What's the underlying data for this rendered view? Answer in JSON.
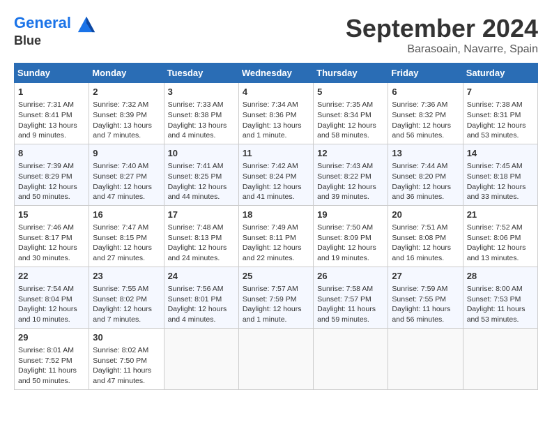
{
  "header": {
    "logo_line1": "General",
    "logo_line2": "Blue",
    "month": "September 2024",
    "location": "Barasoain, Navarre, Spain"
  },
  "weekdays": [
    "Sunday",
    "Monday",
    "Tuesday",
    "Wednesday",
    "Thursday",
    "Friday",
    "Saturday"
  ],
  "weeks": [
    [
      {
        "day": "1",
        "info": "Sunrise: 7:31 AM\nSunset: 8:41 PM\nDaylight: 13 hours\nand 9 minutes."
      },
      {
        "day": "2",
        "info": "Sunrise: 7:32 AM\nSunset: 8:39 PM\nDaylight: 13 hours\nand 7 minutes."
      },
      {
        "day": "3",
        "info": "Sunrise: 7:33 AM\nSunset: 8:38 PM\nDaylight: 13 hours\nand 4 minutes."
      },
      {
        "day": "4",
        "info": "Sunrise: 7:34 AM\nSunset: 8:36 PM\nDaylight: 13 hours\nand 1 minute."
      },
      {
        "day": "5",
        "info": "Sunrise: 7:35 AM\nSunset: 8:34 PM\nDaylight: 12 hours\nand 58 minutes."
      },
      {
        "day": "6",
        "info": "Sunrise: 7:36 AM\nSunset: 8:32 PM\nDaylight: 12 hours\nand 56 minutes."
      },
      {
        "day": "7",
        "info": "Sunrise: 7:38 AM\nSunset: 8:31 PM\nDaylight: 12 hours\nand 53 minutes."
      }
    ],
    [
      {
        "day": "8",
        "info": "Sunrise: 7:39 AM\nSunset: 8:29 PM\nDaylight: 12 hours\nand 50 minutes."
      },
      {
        "day": "9",
        "info": "Sunrise: 7:40 AM\nSunset: 8:27 PM\nDaylight: 12 hours\nand 47 minutes."
      },
      {
        "day": "10",
        "info": "Sunrise: 7:41 AM\nSunset: 8:25 PM\nDaylight: 12 hours\nand 44 minutes."
      },
      {
        "day": "11",
        "info": "Sunrise: 7:42 AM\nSunset: 8:24 PM\nDaylight: 12 hours\nand 41 minutes."
      },
      {
        "day": "12",
        "info": "Sunrise: 7:43 AM\nSunset: 8:22 PM\nDaylight: 12 hours\nand 39 minutes."
      },
      {
        "day": "13",
        "info": "Sunrise: 7:44 AM\nSunset: 8:20 PM\nDaylight: 12 hours\nand 36 minutes."
      },
      {
        "day": "14",
        "info": "Sunrise: 7:45 AM\nSunset: 8:18 PM\nDaylight: 12 hours\nand 33 minutes."
      }
    ],
    [
      {
        "day": "15",
        "info": "Sunrise: 7:46 AM\nSunset: 8:17 PM\nDaylight: 12 hours\nand 30 minutes."
      },
      {
        "day": "16",
        "info": "Sunrise: 7:47 AM\nSunset: 8:15 PM\nDaylight: 12 hours\nand 27 minutes."
      },
      {
        "day": "17",
        "info": "Sunrise: 7:48 AM\nSunset: 8:13 PM\nDaylight: 12 hours\nand 24 minutes."
      },
      {
        "day": "18",
        "info": "Sunrise: 7:49 AM\nSunset: 8:11 PM\nDaylight: 12 hours\nand 22 minutes."
      },
      {
        "day": "19",
        "info": "Sunrise: 7:50 AM\nSunset: 8:09 PM\nDaylight: 12 hours\nand 19 minutes."
      },
      {
        "day": "20",
        "info": "Sunrise: 7:51 AM\nSunset: 8:08 PM\nDaylight: 12 hours\nand 16 minutes."
      },
      {
        "day": "21",
        "info": "Sunrise: 7:52 AM\nSunset: 8:06 PM\nDaylight: 12 hours\nand 13 minutes."
      }
    ],
    [
      {
        "day": "22",
        "info": "Sunrise: 7:54 AM\nSunset: 8:04 PM\nDaylight: 12 hours\nand 10 minutes."
      },
      {
        "day": "23",
        "info": "Sunrise: 7:55 AM\nSunset: 8:02 PM\nDaylight: 12 hours\nand 7 minutes."
      },
      {
        "day": "24",
        "info": "Sunrise: 7:56 AM\nSunset: 8:01 PM\nDaylight: 12 hours\nand 4 minutes."
      },
      {
        "day": "25",
        "info": "Sunrise: 7:57 AM\nSunset: 7:59 PM\nDaylight: 12 hours\nand 1 minute."
      },
      {
        "day": "26",
        "info": "Sunrise: 7:58 AM\nSunset: 7:57 PM\nDaylight: 11 hours\nand 59 minutes."
      },
      {
        "day": "27",
        "info": "Sunrise: 7:59 AM\nSunset: 7:55 PM\nDaylight: 11 hours\nand 56 minutes."
      },
      {
        "day": "28",
        "info": "Sunrise: 8:00 AM\nSunset: 7:53 PM\nDaylight: 11 hours\nand 53 minutes."
      }
    ],
    [
      {
        "day": "29",
        "info": "Sunrise: 8:01 AM\nSunset: 7:52 PM\nDaylight: 11 hours\nand 50 minutes."
      },
      {
        "day": "30",
        "info": "Sunrise: 8:02 AM\nSunset: 7:50 PM\nDaylight: 11 hours\nand 47 minutes."
      },
      {
        "day": "",
        "info": ""
      },
      {
        "day": "",
        "info": ""
      },
      {
        "day": "",
        "info": ""
      },
      {
        "day": "",
        "info": ""
      },
      {
        "day": "",
        "info": ""
      }
    ]
  ]
}
